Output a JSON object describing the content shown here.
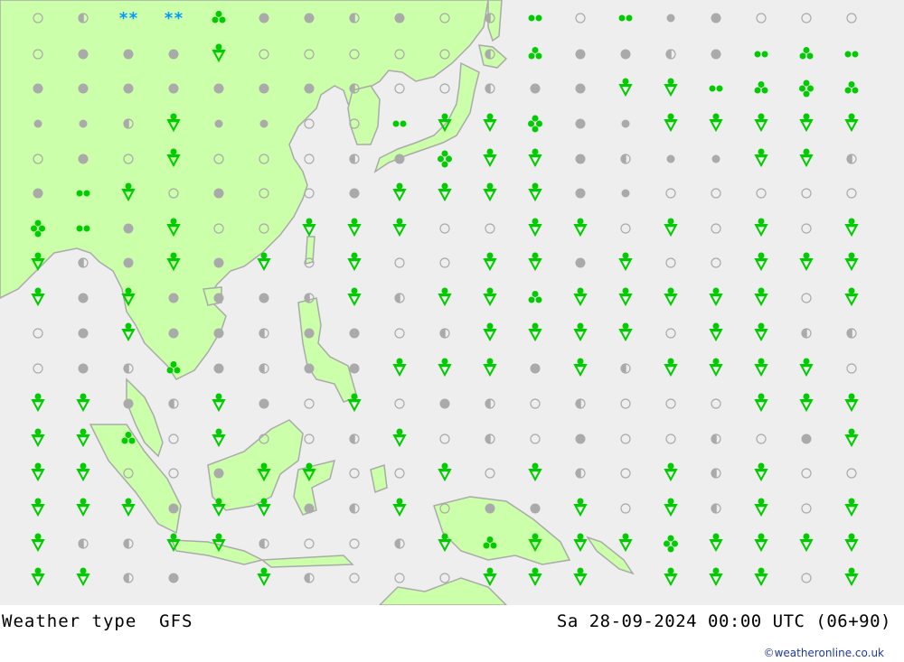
{
  "title": "Weather type",
  "model": "GFS",
  "valid_time": "Sa 28-09-2024 00:00 UTC (06+90)",
  "credit": "©weatheronline.co.uk",
  "colors": {
    "sea": "#eeeeee",
    "land": "#ccffaa",
    "border": "#aaaaaa",
    "rain": "#00cc00",
    "snow": "#0099ff",
    "cloud": "#aaaaaa"
  },
  "legend_codes": {
    "c": "clear",
    "h": "partly-cloudy",
    "s": "cloudy",
    "o": "overcast",
    "S": "rain-showers",
    "R2": "light-rain",
    "R3": "moderate-rain",
    "R4": "heavy-rain",
    "SN": "snow"
  },
  "grid": [
    [
      "c",
      "h",
      "SN",
      "SN",
      "R3",
      "o",
      "o",
      "h",
      "o",
      "c",
      "h",
      "R2",
      "c",
      "R2",
      "s",
      "o",
      "c",
      "c",
      "c"
    ],
    [
      "c",
      "o",
      "o",
      "o",
      "S",
      "c",
      "c",
      "c",
      "c",
      "c",
      "h",
      "R3",
      "o",
      "o",
      "h",
      "o",
      "R2",
      "R3",
      "R2"
    ],
    [
      "o",
      "o",
      "o",
      "o",
      "o",
      "o",
      "o",
      "h",
      "c",
      "c",
      "h",
      "o",
      "o",
      "S",
      "S",
      "R2",
      "R3",
      "R4",
      "R3"
    ],
    [
      "s",
      "s",
      "h",
      "S",
      "s",
      "s",
      "c",
      "c",
      "R2",
      "S",
      "S",
      "R4",
      "o",
      "s",
      "S",
      "S",
      "S",
      "S",
      "S"
    ],
    [
      "c",
      "o",
      "c",
      "S",
      "c",
      "c",
      "c",
      "h",
      "o",
      "R4",
      "S",
      "S",
      "o",
      "h",
      "s",
      "s",
      "S",
      "S",
      "h"
    ],
    [
      "o",
      "R2",
      "S",
      "c",
      "o",
      "c",
      "c",
      "o",
      "S",
      "S",
      "S",
      "S",
      "o",
      "s",
      "c",
      "c",
      "c",
      "c",
      "c"
    ],
    [
      "R4",
      "R2",
      "o",
      "S",
      "c",
      "c",
      "S",
      "S",
      "S",
      "c",
      "c",
      "S",
      "S",
      "c",
      "S",
      "c",
      "S",
      "c",
      "S"
    ],
    [
      "S",
      "h",
      "o",
      "S",
      "o",
      "S",
      "c",
      "S",
      "c",
      "c",
      "S",
      "S",
      "o",
      "S",
      "c",
      "c",
      "S",
      "S",
      "S"
    ],
    [
      "S",
      "o",
      "S",
      "o",
      "o",
      "o",
      "h",
      "S",
      "h",
      "S",
      "S",
      "R3",
      "S",
      "S",
      "S",
      "S",
      "S",
      "c",
      "S"
    ],
    [
      "c",
      "o",
      "S",
      "o",
      "o",
      "h",
      "o",
      "o",
      "c",
      "h",
      "S",
      "S",
      "S",
      "S",
      "c",
      "S",
      "S",
      "h",
      "h"
    ],
    [
      "c",
      "o",
      "h",
      "R3",
      "o",
      "h",
      "o",
      "o",
      "S",
      "S",
      "S",
      "o",
      "S",
      "h",
      "S",
      "S",
      "S",
      "S",
      "c"
    ],
    [
      "S",
      "S",
      "o",
      "h",
      "S",
      "o",
      "c",
      "S",
      "c",
      "o",
      "h",
      "c",
      "h",
      "c",
      "c",
      "c",
      "S",
      "S",
      "S"
    ],
    [
      "S",
      "S",
      "R3",
      "c",
      "S",
      "c",
      "c",
      "h",
      "S",
      "c",
      "h",
      "c",
      "o",
      "c",
      "c",
      "h",
      "c",
      "o",
      "S"
    ],
    [
      "S",
      "S",
      "c",
      "c",
      "o",
      "S",
      "S",
      "c",
      "c",
      "S",
      "c",
      "S",
      "h",
      "c",
      "S",
      "h",
      "S",
      "c",
      "c"
    ],
    [
      "S",
      "S",
      "S",
      "o",
      "S",
      "S",
      "o",
      "h",
      "S",
      "c",
      "o",
      "o",
      "S",
      "c",
      "S",
      "h",
      "S",
      "c",
      "S"
    ],
    [
      "S",
      "h",
      "h",
      "S",
      "S",
      "h",
      "c",
      "c",
      "h",
      "S",
      "R3",
      "S",
      "S",
      "S",
      "R4",
      "S",
      "S",
      "S",
      "S"
    ],
    [
      "S",
      "S",
      "h",
      "o",
      "",
      "S",
      "h",
      "c",
      "c",
      "c",
      "S",
      "S",
      "S",
      "",
      "S",
      "S",
      "S",
      "c",
      "S"
    ]
  ]
}
